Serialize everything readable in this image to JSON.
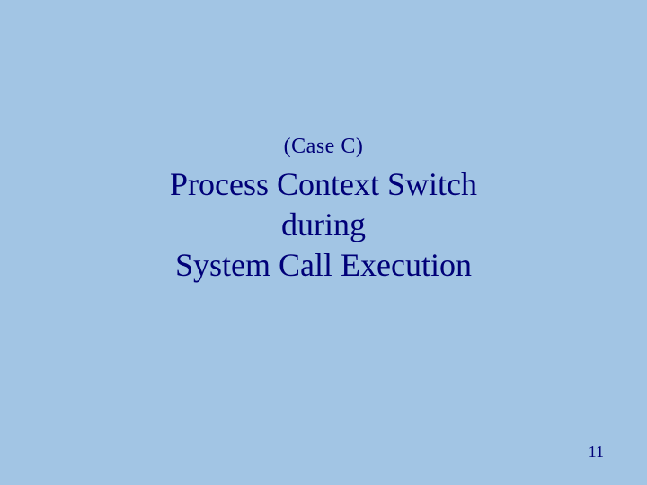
{
  "slide": {
    "case_label": "(Case C)",
    "title_line1": "Process Context Switch",
    "title_line2": "during",
    "title_line3": "System Call  Execution",
    "page_number": "11"
  }
}
